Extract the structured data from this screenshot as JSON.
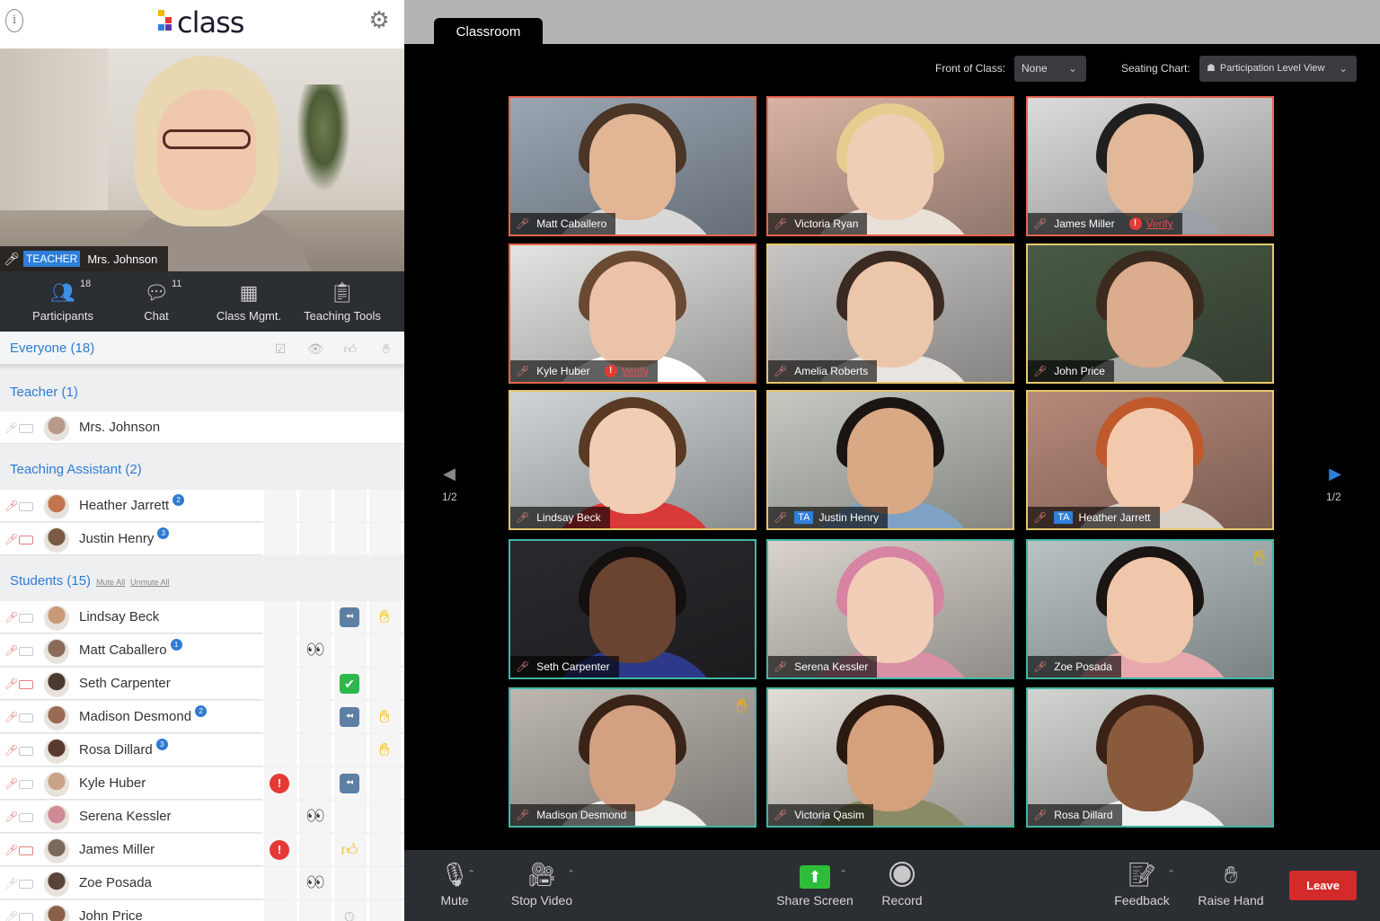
{
  "app": {
    "logo_text": "class",
    "logo_colors": [
      "#f5b800",
      "#e53935",
      "#2e7fd9",
      "#5e35b1"
    ]
  },
  "teacher_video": {
    "role_badge": "TEACHER",
    "name": "Mrs. Johnson"
  },
  "tabs": [
    {
      "label": "Participants",
      "count": "18",
      "icon": "participants-icon"
    },
    {
      "label": "Chat",
      "count": "11",
      "icon": "chat-icon"
    },
    {
      "label": "Class Mgmt.",
      "count": "",
      "icon": "class-mgmt-icon"
    },
    {
      "label": "Teaching Tools",
      "count": "",
      "icon": "teaching-tools-icon"
    }
  ],
  "participants": {
    "everyone_label": "Everyone (18)",
    "column_icons": [
      "check-icon",
      "eye-icon",
      "thumbs-up-icon",
      "hand-icon"
    ],
    "teacher_section": {
      "title": "Teacher (1)"
    },
    "ta_section": {
      "title": "Teaching Assistant (2)"
    },
    "students_section": {
      "title": "Students (15)",
      "mute_all": "Mute All",
      "unmute_all": "Unmute All"
    },
    "teacher": [
      {
        "name": "Mrs. Johnson",
        "badge": "",
        "muted": false,
        "cam_off": false,
        "avatar": "#b89a8a",
        "statuses": []
      }
    ],
    "tas": [
      {
        "name": "Heather Jarrett",
        "badge": "2",
        "muted": true,
        "cam_off": false,
        "avatar": "#c2744f",
        "statuses": []
      },
      {
        "name": "Justin Henry",
        "badge": "3",
        "muted": true,
        "cam_off": true,
        "avatar": "#7a5a44",
        "statuses": []
      }
    ],
    "students": [
      {
        "name": "Lindsay Beck",
        "badge": "",
        "muted": true,
        "cam_off": false,
        "avatar": "#c89a7a",
        "statuses": [
          "",
          "",
          "rewind",
          "hand"
        ]
      },
      {
        "name": "Matt Caballero",
        "badge": "1",
        "muted": true,
        "cam_off": false,
        "avatar": "#8a6a58",
        "statuses": [
          "",
          "eyes",
          "",
          ""
        ]
      },
      {
        "name": "Seth Carpenter",
        "badge": "",
        "muted": true,
        "cam_off": true,
        "avatar": "#4a3a32",
        "statuses": [
          "",
          "",
          "check",
          ""
        ]
      },
      {
        "name": "Madison Desmond",
        "badge": "2",
        "muted": true,
        "cam_off": false,
        "avatar": "#9a6a55",
        "statuses": [
          "",
          "",
          "rewind",
          "hand"
        ]
      },
      {
        "name": "Rosa Dillard",
        "badge": "3",
        "muted": true,
        "cam_off": false,
        "avatar": "#5a3a2c",
        "statuses": [
          "",
          "",
          "",
          "hand"
        ]
      },
      {
        "name": "Kyle Huber",
        "badge": "",
        "muted": true,
        "cam_off": false,
        "avatar": "#c9a288",
        "statuses": [
          "alert",
          "",
          "rewind",
          ""
        ]
      },
      {
        "name": "Serena Kessler",
        "badge": "",
        "muted": true,
        "cam_off": false,
        "avatar": "#d08a95",
        "statuses": [
          "",
          "eyes",
          "",
          ""
        ]
      },
      {
        "name": "James Miller",
        "badge": "",
        "muted": true,
        "cam_off": true,
        "avatar": "#7a6a5a",
        "statuses": [
          "alert",
          "",
          "thumb",
          ""
        ]
      },
      {
        "name": "Zoe Posada",
        "badge": "",
        "muted": false,
        "cam_off": false,
        "avatar": "#5a4438",
        "statuses": [
          "",
          "eyes",
          "",
          ""
        ]
      },
      {
        "name": "John Price",
        "badge": "",
        "muted": false,
        "cam_off": false,
        "avatar": "#8a6048",
        "statuses": [
          "",
          "",
          "clock",
          ""
        ]
      }
    ]
  },
  "classroom": {
    "tab_label": "Classroom",
    "front_of_class_label": "Front of Class:",
    "front_of_class_value": "None",
    "seating_chart_label": "Seating Chart:",
    "seating_chart_value": "Participation Level View",
    "page_indicator": "1/2",
    "verify_text": "Verify",
    "ta_badge": "TA",
    "tiles": [
      {
        "name": "Matt Caballero",
        "border": "#e8654f",
        "bg": "#9aa6b3",
        "skin": "#e2b595",
        "hair": "#4a3526",
        "shirt": "#d8d8d8",
        "ta": false,
        "verify": false,
        "hand": false
      },
      {
        "name": "Victoria Ryan",
        "border": "#e8654f",
        "bg": "#d9b3a3",
        "skin": "#f0cdb5",
        "hair": "#e6cc8f",
        "shirt": "#e9e0d8",
        "ta": false,
        "verify": false,
        "hand": false
      },
      {
        "name": "James Miller",
        "border": "#e8654f",
        "bg": "#dcdcdc",
        "skin": "#e2b898",
        "hair": "#1f1f1f",
        "shirt": "#9aa0a6",
        "ta": false,
        "verify": true,
        "hand": false
      },
      {
        "name": "Kyle Huber",
        "border": "#e8654f",
        "bg": "#e4e4e2",
        "skin": "#ebc3a8",
        "hair": "#6a4a32",
        "shirt": "#ffffff",
        "ta": false,
        "verify": true,
        "hand": false
      },
      {
        "name": "Amelia Roberts",
        "border": "#e6c86a",
        "bg": "#c8c6c3",
        "skin": "#ecc6aa",
        "hair": "#3a2a22",
        "shirt": "#e8e4df",
        "ta": false,
        "verify": false,
        "hand": false
      },
      {
        "name": "John Price",
        "border": "#e6c86a",
        "bg": "#4a5a46",
        "skin": "#dcac8e",
        "hair": "#3b2a1e",
        "shirt": "#a8a8a4",
        "ta": false,
        "verify": false,
        "hand": false
      },
      {
        "name": "Lindsay Beck",
        "border": "#e6c86a",
        "bg": "#cfd4d6",
        "skin": "#f1cdb3",
        "hair": "#5a3a24",
        "shirt": "#d83a3a",
        "ta": false,
        "verify": false,
        "hand": false
      },
      {
        "name": "Justin Henry",
        "border": "#e6c86a",
        "bg": "#c5c9c2",
        "skin": "#d9a884",
        "hair": "#1a1412",
        "shirt": "#7fa2c4",
        "ta": true,
        "verify": false,
        "hand": false
      },
      {
        "name": "Heather Jarrett",
        "border": "#e6c86a",
        "bg": "#b78a7a",
        "skin": "#f2c9ac",
        "hair": "#c0592c",
        "shirt": "#d9d0c8",
        "ta": true,
        "verify": false,
        "hand": false
      },
      {
        "name": "Seth Carpenter",
        "border": "#3fb7a6",
        "bg": "#2a2a2e",
        "skin": "#6a4430",
        "hair": "#141010",
        "shirt": "#2d3a8a",
        "ta": false,
        "verify": false,
        "hand": false
      },
      {
        "name": "Serena Kessler",
        "border": "#3fb7a6",
        "bg": "#d9d3cc",
        "skin": "#f2cdb8",
        "hair": "#d784a3",
        "shirt": "#d890a4",
        "ta": false,
        "verify": false,
        "hand": false
      },
      {
        "name": "Zoe Posada",
        "border": "#3fb7a6",
        "bg": "#b9c3c4",
        "skin": "#f0c7aa",
        "hair": "#1a1412",
        "shirt": "#e7a9ae",
        "ta": false,
        "verify": false,
        "hand": true
      },
      {
        "name": "Madison Desmond",
        "border": "#3fb7a6",
        "bg": "#bdb7b0",
        "skin": "#d4a082",
        "hair": "#3a2418",
        "shirt": "#f0eeea",
        "ta": false,
        "verify": false,
        "hand": true
      },
      {
        "name": "Victoria Qasim",
        "border": "#3fb7a6",
        "bg": "#e2ddd6",
        "skin": "#d5a07c",
        "hair": "#2a1a12",
        "shirt": "#8a8a66",
        "ta": false,
        "verify": false,
        "hand": false
      },
      {
        "name": "Rosa Dillard",
        "border": "#3fb7a6",
        "bg": "#d2d4d2",
        "skin": "#8a5a3c",
        "hair": "#3a2216",
        "shirt": "#f0f0f0",
        "ta": false,
        "verify": false,
        "hand": false
      }
    ]
  },
  "controls": {
    "mute": "Mute",
    "stop_video": "Stop Video",
    "share_screen": "Share Screen",
    "record": "Record",
    "feedback": "Feedback",
    "raise_hand": "Raise Hand",
    "leave": "Leave"
  }
}
